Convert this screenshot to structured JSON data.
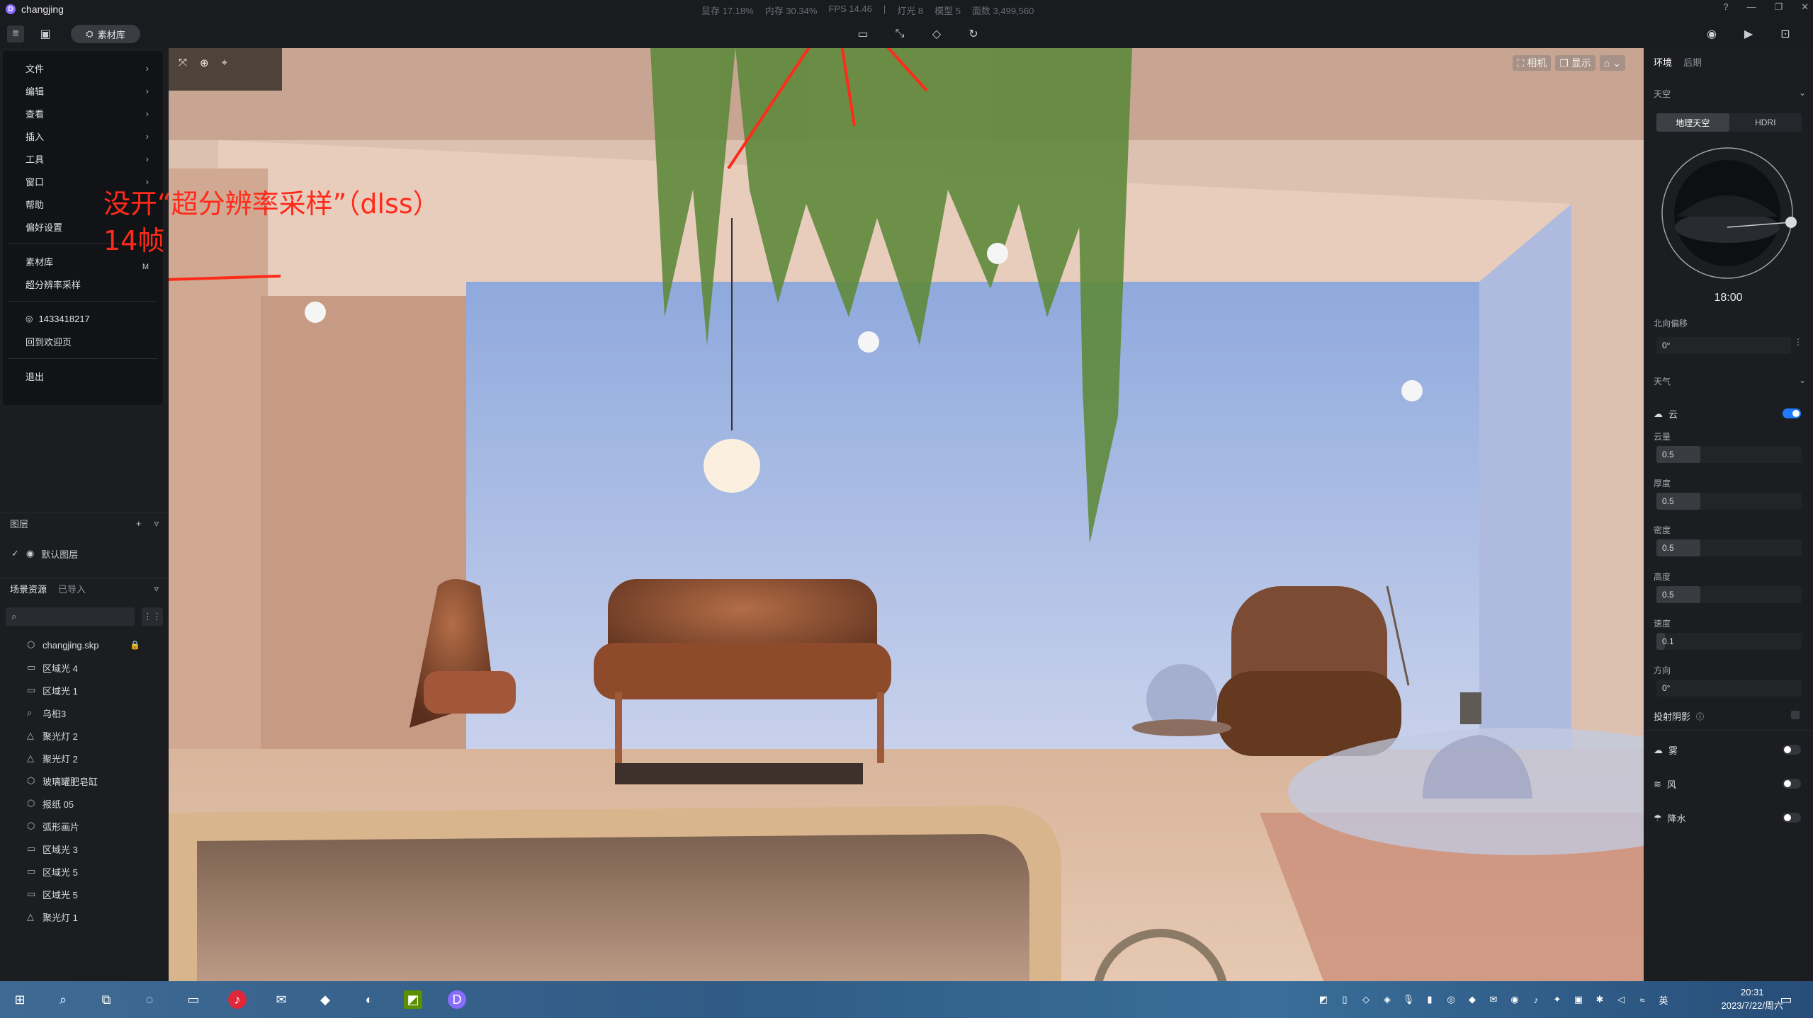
{
  "app": {
    "name": "changjing"
  },
  "stats": {
    "vram": "显存 17.18%",
    "memory": "内存 30.34%",
    "fps": "FPS 14.46",
    "sep": "|",
    "lights": "灯光 8",
    "models": "模型 5",
    "faces": "面数 3,499,560"
  },
  "toolbar": {
    "library_label": "素材库"
  },
  "menu": {
    "items": [
      {
        "label": "文件",
        "arrow": "›"
      },
      {
        "label": "编辑",
        "arrow": "›"
      },
      {
        "label": "查看",
        "arrow": "›"
      },
      {
        "label": "插入",
        "arrow": "›"
      },
      {
        "label": "工具",
        "arrow": "›"
      },
      {
        "label": "窗口",
        "arrow": "›"
      },
      {
        "label": "帮助",
        "arrow": ""
      },
      {
        "label": "偏好设置",
        "arrow": ""
      }
    ],
    "library": {
      "label": "素材库",
      "shortcut": "M"
    },
    "super_res": "超分辨率采样",
    "account": "1433418217",
    "back_home": "回到欢迎页",
    "exit": "退出"
  },
  "annotation": {
    "line1": "没开“超分辨率采样”（dlss）",
    "line2": "14帧"
  },
  "layers": {
    "title": "图层",
    "default_layer": "默认图层"
  },
  "scene_assets": {
    "title": "场景资源",
    "tab_imported": "已导入",
    "items": [
      {
        "icon": "model-icon",
        "glyph": "⬡",
        "name": "changjing.skp",
        "locked": true
      },
      {
        "icon": "area-light-icon",
        "glyph": "▭",
        "name": "区域光 4"
      },
      {
        "icon": "area-light-icon",
        "glyph": "▭",
        "name": "区域光 1"
      },
      {
        "icon": "plant-icon",
        "glyph": "⌕",
        "name": "乌桕3"
      },
      {
        "icon": "spot-light-icon",
        "glyph": "△",
        "name": "聚光灯 2"
      },
      {
        "icon": "spot-light-icon",
        "glyph": "△",
        "name": "聚光灯 2"
      },
      {
        "icon": "model-icon",
        "glyph": "⬡",
        "name": "玻璃罐肥皂缸"
      },
      {
        "icon": "model-icon",
        "glyph": "⬡",
        "name": "报纸 05"
      },
      {
        "icon": "model-icon",
        "glyph": "⬡",
        "name": "弧形画片"
      },
      {
        "icon": "area-light-icon",
        "glyph": "▭",
        "name": "区域光 3"
      },
      {
        "icon": "area-light-icon",
        "glyph": "▭",
        "name": "区域光 5"
      },
      {
        "icon": "area-light-icon",
        "glyph": "▭",
        "name": "区域光 5"
      },
      {
        "icon": "spot-light-icon",
        "glyph": "△",
        "name": "聚光灯 1"
      }
    ]
  },
  "viewport": {
    "camera_label": "相机",
    "display_label": "显示"
  },
  "right_panel": {
    "tab_env": "环境",
    "tab_post": "后期",
    "sky_section": "天空",
    "sky_geo": "地理天空",
    "sky_hdri": "HDRI",
    "time": "18:00",
    "north_offset_label": "北向偏移",
    "north_offset_value": "0°",
    "weather_section": "天气",
    "cloud_label": "云",
    "cloud_on": true,
    "params": [
      {
        "label": "云量",
        "value": "0.5",
        "fraction": 0.3
      },
      {
        "label": "厚度",
        "value": "0.5",
        "fraction": 0.3
      },
      {
        "label": "密度",
        "value": "0.5",
        "fraction": 0.3
      },
      {
        "label": "高度",
        "value": "0.5",
        "fraction": 0.3
      },
      {
        "label": "速度",
        "value": "0.1",
        "fraction": 0.06
      },
      {
        "label": "方向",
        "value": "0°",
        "fraction": 0
      }
    ],
    "cast_shadow": "投射阴影",
    "fog_label": "雾",
    "wind_label": "风",
    "rain_label": "降水"
  },
  "taskbar": {
    "clock_time": "20:31",
    "clock_date": "2023/7/22/周六",
    "lang": "英"
  },
  "colors": {
    "accent": "#1e7bff",
    "annotation": "#ff2a1a"
  }
}
